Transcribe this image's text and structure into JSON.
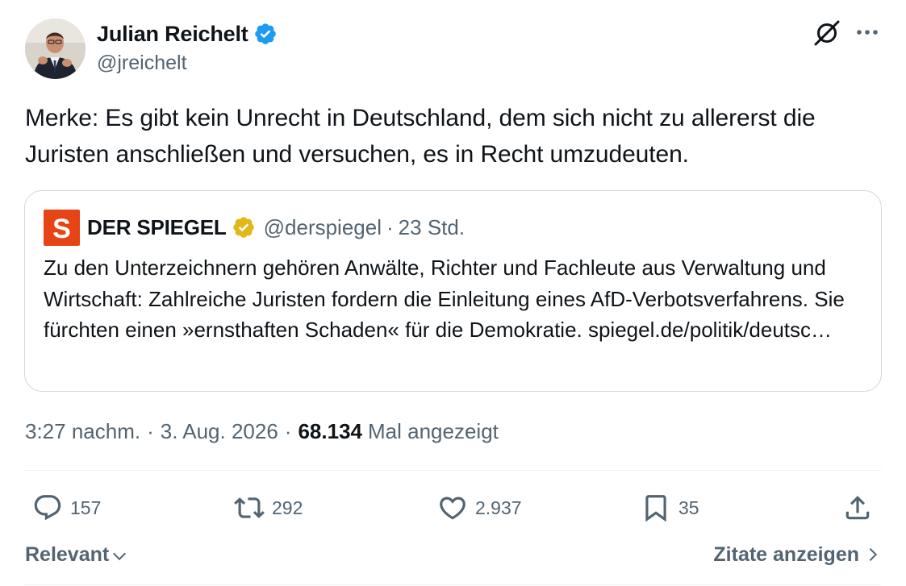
{
  "author": {
    "display_name": "Julian Reichelt",
    "handle": "@jreichelt",
    "verified": true,
    "verified_color": "#1d9bf0"
  },
  "tweet": {
    "text": "Merke: Es gibt kein Unrecht in Deutschland, dem sich nicht zu allererst die Juristen anschließen und versuchen, es in Recht umzudeuten."
  },
  "quoted": {
    "display_name": "DER SPIEGEL",
    "handle": "@derspiegel",
    "separator": "·",
    "time": "23 Std.",
    "logo_letter": "S",
    "logo_color": "#e64415",
    "badge_color": "#e2b719",
    "text": "Zu den Unterzeichnern gehören Anwälte, Richter und Fachleute aus Verwaltung und Wirtschaft: Zahlreiche Juristen fordern die Einleitung eines AfD-Verbotsverfahrens. Sie fürchten einen »ernsthaften Schaden« für die Demokratie. spiegel.de/politik/deutsc…"
  },
  "meta": {
    "time": "3:27 nachm.",
    "separator": "·",
    "date": "3. Aug. 2026",
    "views_count": "68.134",
    "views_label": "Mal angezeigt"
  },
  "actions": {
    "replies": "157",
    "reposts": "292",
    "likes": "2.937",
    "bookmarks": "35"
  },
  "footer": {
    "sort_label": "Relevant",
    "quotes_label": "Zitate anzeigen"
  },
  "icons": {
    "grok": "grok-icon",
    "more": "more-icon",
    "reply": "reply-icon",
    "repost": "repost-icon",
    "like": "heart-icon",
    "bookmark": "bookmark-icon",
    "share": "share-icon"
  },
  "colors": {
    "text_primary": "#0f1419",
    "text_secondary": "#536471",
    "border": "#cfd9de",
    "divider": "#eff3f4"
  }
}
